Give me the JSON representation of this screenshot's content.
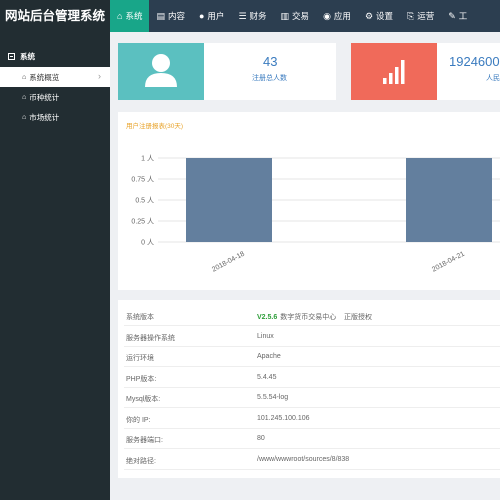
{
  "brand": "网站后台管理系统",
  "nav": [
    {
      "label": "系统",
      "icon": "home-icon",
      "glyph": "⌂",
      "active": true
    },
    {
      "label": "内容",
      "icon": "content-icon",
      "glyph": "▤"
    },
    {
      "label": "用户",
      "icon": "user-icon",
      "glyph": "●"
    },
    {
      "label": "财务",
      "icon": "finance-icon",
      "glyph": "☰"
    },
    {
      "label": "交易",
      "icon": "trade-icon",
      "glyph": "▥"
    },
    {
      "label": "应用",
      "icon": "app-icon",
      "glyph": "◉"
    },
    {
      "label": "设置",
      "icon": "gear-icon",
      "glyph": "⚙"
    },
    {
      "label": "运营",
      "icon": "operation-icon",
      "glyph": "⎘"
    },
    {
      "label": "工",
      "icon": "tool-icon",
      "glyph": "✎"
    }
  ],
  "sidebar": {
    "group": "系统",
    "items": [
      {
        "label": "系统概览",
        "icon": "home-icon",
        "active": true
      },
      {
        "label": "币种统计",
        "icon": "home-icon"
      },
      {
        "label": "市场统计",
        "icon": "home-icon"
      }
    ]
  },
  "cards": [
    {
      "value": "43",
      "label": "注册总人数",
      "icon": "user-icon",
      "color": "#5bc0c0"
    },
    {
      "value": "1924600",
      "label": "人民",
      "icon": "signal-bars-icon",
      "color": "#f06a5a"
    }
  ],
  "chart": {
    "title": "用户注册报表(30天)"
  },
  "chart_data": {
    "type": "bar",
    "title": "用户注册报表(30天)",
    "categories": [
      "2018-04-18",
      "",
      "2018-04-21",
      ""
    ],
    "values": [
      1,
      0,
      1,
      0
    ],
    "ylim": [
      0,
      1
    ],
    "yticks": [
      "0 人",
      "0.25 人",
      "0.5 人",
      "0.75 人",
      "1 人"
    ],
    "grid": true,
    "bar_color": "#637f9e"
  },
  "info": [
    {
      "key": "系统版本",
      "value": "",
      "version": "V2.5.6",
      "extra": "数字货币交易中心    正版授权"
    },
    {
      "key": "服务器操作系统",
      "value": "Linux"
    },
    {
      "key": "运行环境",
      "value": "Apache"
    },
    {
      "key": "PHP版本:",
      "value": "5.4.45"
    },
    {
      "key": "Mysql版本:",
      "value": "5.5.54-log"
    },
    {
      "key": "你的 IP:",
      "value": "101.245.100.106"
    },
    {
      "key": "服务器端口:",
      "value": "80"
    },
    {
      "key": "绝对路径:",
      "value": "/www/wwwroot/sources/8/838"
    }
  ]
}
